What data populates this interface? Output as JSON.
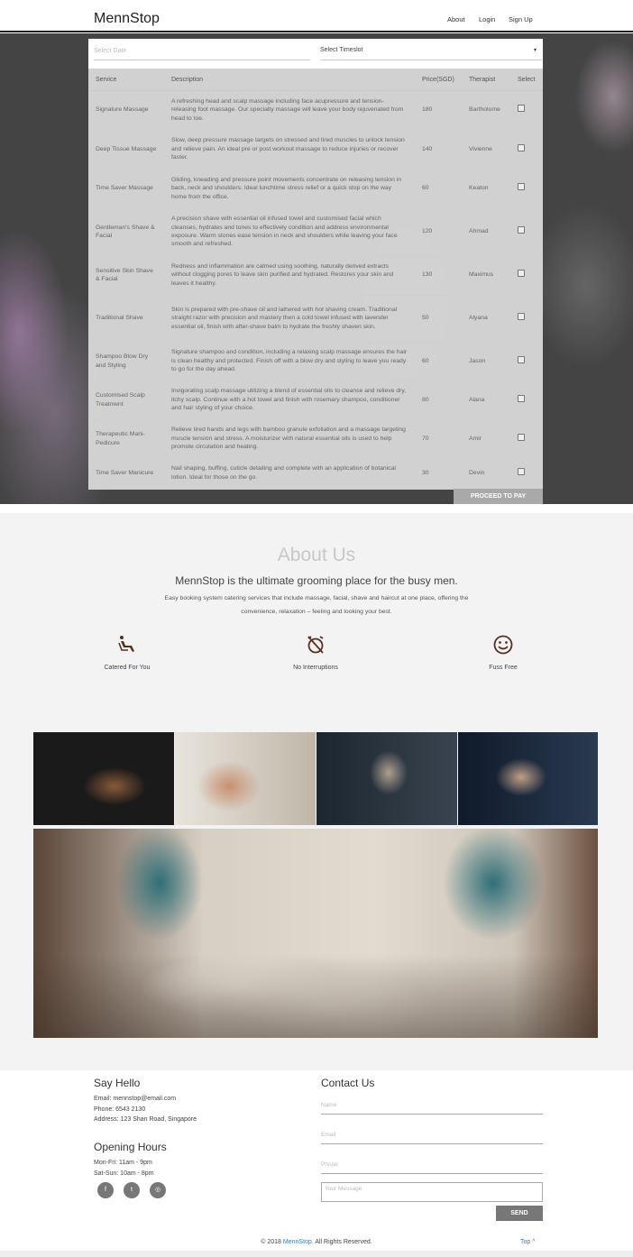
{
  "nav": {
    "brand": "MennStop",
    "about": "About",
    "login": "Login",
    "signup": "Sign Up"
  },
  "booking": {
    "date_placeholder": "Select Date",
    "timeslot_placeholder": "Select Timeslot",
    "caret": "▾",
    "columns": [
      "Service",
      "Description",
      "Price(SGD)",
      "Therapist",
      "Select"
    ],
    "rows": [
      {
        "service": "Signature Massage",
        "description": "A refreshing head and scalp massage including face acupressure and tension-releasing foot massage. Our specialty massage will leave your body rejuvenated from head to toe.",
        "price": "180",
        "therapist": "Bartholome"
      },
      {
        "service": "Deep Tissue Massage",
        "description": "Slow, deep pressure massage targets on stressed and tired muscles to unlock tension and relieve pain. An ideal pre or post workout massage to reduce injuries or recover faster.",
        "price": "140",
        "therapist": "Vivienne"
      },
      {
        "service": "Time Saver Massage",
        "description": "Gliding, kneading and pressure point movements concentrate on releasing tension in back, neck and shoulders. Ideal lunchtime stress relief or a quick stop on the way home from the office.",
        "price": "60",
        "therapist": "Keaton"
      },
      {
        "service": "Gentleman's Shave & Facial",
        "description": "A precision shave with essential oil infused towel and customised facial which cleanses, hydrates and tones to effectively condition and address environmental exposure. Warm stones ease tension in neck and shoulders while leaving your face smooth and refreshed.",
        "price": "120",
        "therapist": "Ahmad"
      },
      {
        "service": "Sensitive Skin Shave & Facial",
        "description": "Redness and inflammation are calmed using soothing, naturally derived extracts without clogging pores to leave skin purified and hydrated. Restores your skin and leaves it healthy.",
        "price": "130",
        "therapist": "Maximus"
      },
      {
        "service": "Traditional Shave",
        "description": "Skin is prepared with pre-shave oil and lathered with hot shaving cream. Traditional straight razor with precision and mastery then a cold towel infused with lavender essential oil, finish with after-shave balm to hydrate the freshly shaven skin.",
        "price": "50",
        "therapist": "Alyana"
      },
      {
        "service": "Shampoo Blow Dry and Styling",
        "description": "Signature shampoo and condition, including a relaxing scalp massage ensures the hair is clean healthy and protected. Finish off with a blow dry and styling to leave you ready to go for the day ahead.",
        "price": "60",
        "therapist": "Jason"
      },
      {
        "service": "Customised Scalp Treatment",
        "description": "Invigorating scalp massage utilizing a blend of essential oils to cleanse and relieve dry, itchy scalp. Continue with a hot towel and finish with rosemary shampoo, conditioner and hair styling of your choice.",
        "price": "80",
        "therapist": "Alana"
      },
      {
        "service": "Therapeutic Mani-Pedicure",
        "description": "Relieve tired hands and legs with bamboo granule exfoliation and a massage targeting muscle tension and stress. A moisturizer with natural essential oils is used to help promote circulation and healing.",
        "price": "70",
        "therapist": "Amir"
      },
      {
        "service": "Time Saver Manicure",
        "description": "Nail shaping, buffing, cuticle detailing and complete with an application of botanical lotion. Ideal for those on the go.",
        "price": "30",
        "therapist": "Devin"
      }
    ],
    "proceed_label": "PROCEED TO PAY"
  },
  "about": {
    "title": "About Us",
    "subtitle": "MennStop is the ultimate grooming place for the busy men.",
    "body": "Easy booking system catering services that include massage, facial, shave and haircut at one place, offering the convenience, relaxation – feeling and looking your best.",
    "features": [
      {
        "icon": "reclining-seat-icon",
        "label": "Catered For You"
      },
      {
        "icon": "alarm-off-icon",
        "label": "No Interruptions"
      },
      {
        "icon": "smiley-face-icon",
        "label": "Fuss Free"
      }
    ]
  },
  "footer": {
    "say_hello": "Say Hello",
    "email": "Email: mennstop@email.com",
    "phone": "Phone: 6543 2130",
    "address": "Address: 123 Shan Road, Singapore",
    "hours_title": "Opening Hours",
    "hours_weekday": "Mon-Fri: 11am - 9pm",
    "hours_weekend": "Sat-Sun: 10am - 8pm",
    "social": [
      "f",
      "t",
      "◎"
    ],
    "contact_title": "Contact Us",
    "name_placeholder": "Name",
    "email_placeholder": "Email",
    "phone_placeholder": "Phone",
    "message_placeholder": "Your Message",
    "send_label": "SEND",
    "copyright_prefix": "© 2018",
    "copyright_brand": "MennStop",
    "copyright_suffix": ". All Rights Reserved.",
    "top_label": "Top ^"
  },
  "colors": {
    "hero_bg": "#444444",
    "accent_link": "#3a7bbf",
    "icon_brown": "#5a2e22"
  }
}
